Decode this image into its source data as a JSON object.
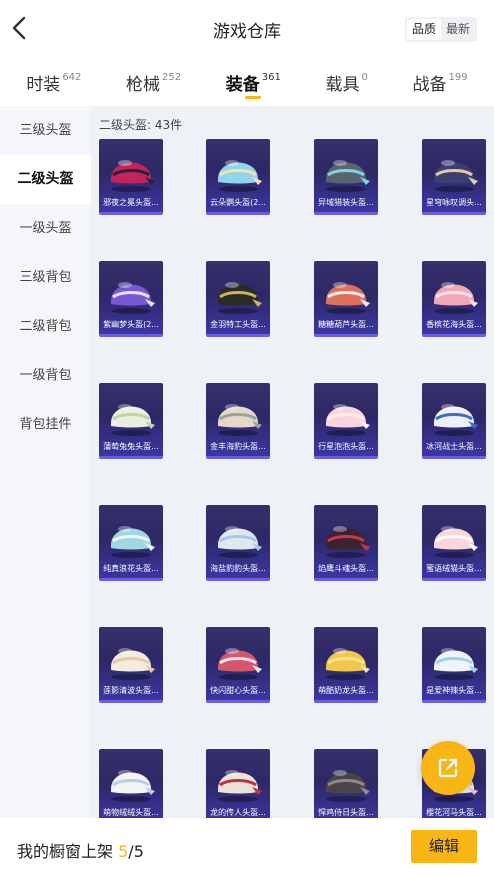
{
  "header": {
    "title": "游戏仓库",
    "sort_options": [
      {
        "label": "品质",
        "active": true
      },
      {
        "label": "最新",
        "active": false
      }
    ]
  },
  "tabs": [
    {
      "label": "时装",
      "count": "642",
      "active": false
    },
    {
      "label": "枪械",
      "count": "252",
      "active": false
    },
    {
      "label": "装备",
      "count": "361",
      "active": true
    },
    {
      "label": "载具",
      "count": "0",
      "active": false
    },
    {
      "label": "战备",
      "count": "199",
      "active": false
    }
  ],
  "sidebar": {
    "items": [
      {
        "label": "三级头盔",
        "active": false
      },
      {
        "label": "二级头盔",
        "active": true
      },
      {
        "label": "一级头盔",
        "active": false
      },
      {
        "label": "三级背包",
        "active": false
      },
      {
        "label": "二级背包",
        "active": false
      },
      {
        "label": "一级背包",
        "active": false
      },
      {
        "label": "背包挂件",
        "active": false
      }
    ]
  },
  "content": {
    "count_label": "二级头盔: 43件",
    "items": [
      {
        "name": "邪夜之冕头盔...",
        "color": "#c2245a",
        "accent": "#2a2238"
      },
      {
        "name": "云朵鹦头盔(2...",
        "color": "#8fd6ea",
        "accent": "#f2e3b4"
      },
      {
        "name": "异域猎装头盔...",
        "color": "#5a6470",
        "accent": "#7fd6e0"
      },
      {
        "name": "星穹咏叹调头...",
        "color": "#3c3f6e",
        "accent": "#e7c9a2"
      },
      {
        "name": "紫幽梦头盔(2...",
        "color": "#7a58d4",
        "accent": "#e8e4f6"
      },
      {
        "name": "金羽特工头盔...",
        "color": "#2b2b26",
        "accent": "#c8b25a"
      },
      {
        "name": "糖糖葫芦头盔...",
        "color": "#e0705e",
        "accent": "#f2ece4"
      },
      {
        "name": "香槟花海头盔...",
        "color": "#f2a8b4",
        "accent": "#fbe4e8"
      },
      {
        "name": "蒲萄兔兔头盔...",
        "color": "#eceee4",
        "accent": "#b9d6a8"
      },
      {
        "name": "金丰海豹头盔...",
        "color": "#e6d8c8",
        "accent": "#8fa89a"
      },
      {
        "name": "行星泡泡头盔...",
        "color": "#f8d4dc",
        "accent": "#fbefe4"
      },
      {
        "name": "冰河战士头盔...",
        "color": "#eef2f8",
        "accent": "#3a6fc4"
      },
      {
        "name": "纯真浪花头盔...",
        "color": "#9fd8e4",
        "accent": "#f4f4f0"
      },
      {
        "name": "海盐豹豹头盔...",
        "color": "#dfe8f2",
        "accent": "#a9c8e6"
      },
      {
        "name": "焰鹰斗魂头盔...",
        "color": "#3a2430",
        "accent": "#d0344a"
      },
      {
        "name": "蜜语绒猫头盔...",
        "color": "#f7d6dc",
        "accent": "#ffffff"
      },
      {
        "name": "莲影清波头盔...",
        "color": "#f3ecde",
        "accent": "#e8c9a6"
      },
      {
        "name": "快闪甜心头盔...",
        "color": "#d6566e",
        "accent": "#f4e4e8"
      },
      {
        "name": "萌酷奶龙头盔...",
        "color": "#f2c648",
        "accent": "#fbe39a"
      },
      {
        "name": "是爱神辣头盔...",
        "color": "#eef4f8",
        "accent": "#9fd4e8"
      },
      {
        "name": "萌物绒绒头盔...",
        "color": "#f2f4f6",
        "accent": "#b8d0e4"
      },
      {
        "name": "龙的传人头盔...",
        "color": "#e8e2d8",
        "accent": "#c4303c"
      },
      {
        "name": "悍鸡侍日头盔...",
        "color": "#4a4448",
        "accent": "#8e8a86"
      },
      {
        "name": "樱花河马头盔...",
        "color": "#eef0f4",
        "accent": "#f4b8c4"
      }
    ]
  },
  "bottom_bar": {
    "label": "我的橱窗上架",
    "current": "5",
    "total": "/5",
    "edit_label": "编辑"
  },
  "colors": {
    "accent": "#f7b614",
    "item_bg": "#2d2866",
    "sidebar_bg": "#f4f6f9",
    "content_bg": "#eef2f6"
  }
}
